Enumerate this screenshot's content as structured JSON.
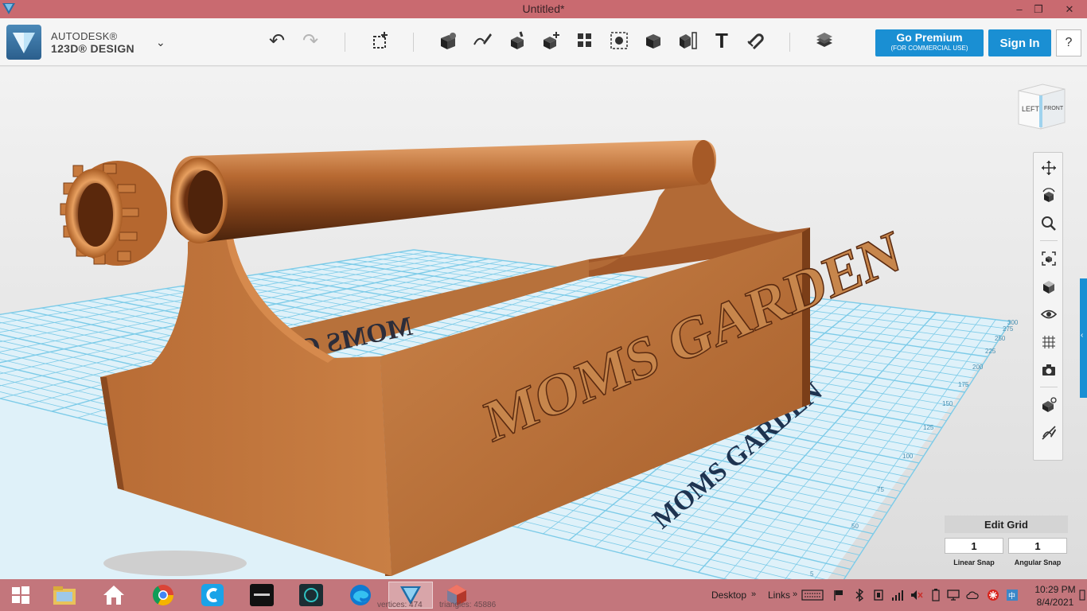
{
  "window": {
    "title": "Untitled*",
    "controls": {
      "minimize": "–",
      "restore": "❐",
      "close": "✕"
    }
  },
  "toolbar": {
    "brand_line1": "AUTODESK®",
    "brand_line2": "123D® DESIGN",
    "menu_chevron": "⌄",
    "undo": "↶",
    "redo": "↷",
    "text_tool": "T",
    "go_premium": "Go Premium",
    "go_premium_sub": "(FOR COMMERCIAL USE)",
    "sign_in": "Sign In",
    "help": "?"
  },
  "viewport": {
    "viewcube": {
      "left": "LEFT",
      "front": "FRONT"
    },
    "model_text": "MOMS GARDEN",
    "mirrored_text": "MOMS GARDEN",
    "ground_text": "MOMS GARDEN",
    "grid_tick_labels": [
      "5",
      "25",
      "50",
      "75",
      "100",
      "125",
      "150",
      "175",
      "200",
      "225",
      "250",
      "275",
      "300"
    ],
    "edge_tab_arrow": "‹"
  },
  "grid_panel": {
    "title": "Edit Grid",
    "linear_snap_value": "1",
    "angular_snap_value": "1",
    "linear_snap_label": "Linear Snap",
    "angular_snap_label": "Angular Snap"
  },
  "taskbar": {
    "desktop_label": "Desktop",
    "links_label": "Links",
    "ghost_vertices": "vertices: 474",
    "ghost_triangles": "triangles: 45886",
    "time": "10:29 PM",
    "date": "8/4/2021",
    "overflow_arrow": "»"
  },
  "colors": {
    "accent": "#1a8fd3",
    "titlebar": "#c96a70",
    "taskbar": "#c3767c",
    "wood": "#c0743a",
    "grid": "#5fbfe0",
    "ground_text": "#1e3350"
  }
}
